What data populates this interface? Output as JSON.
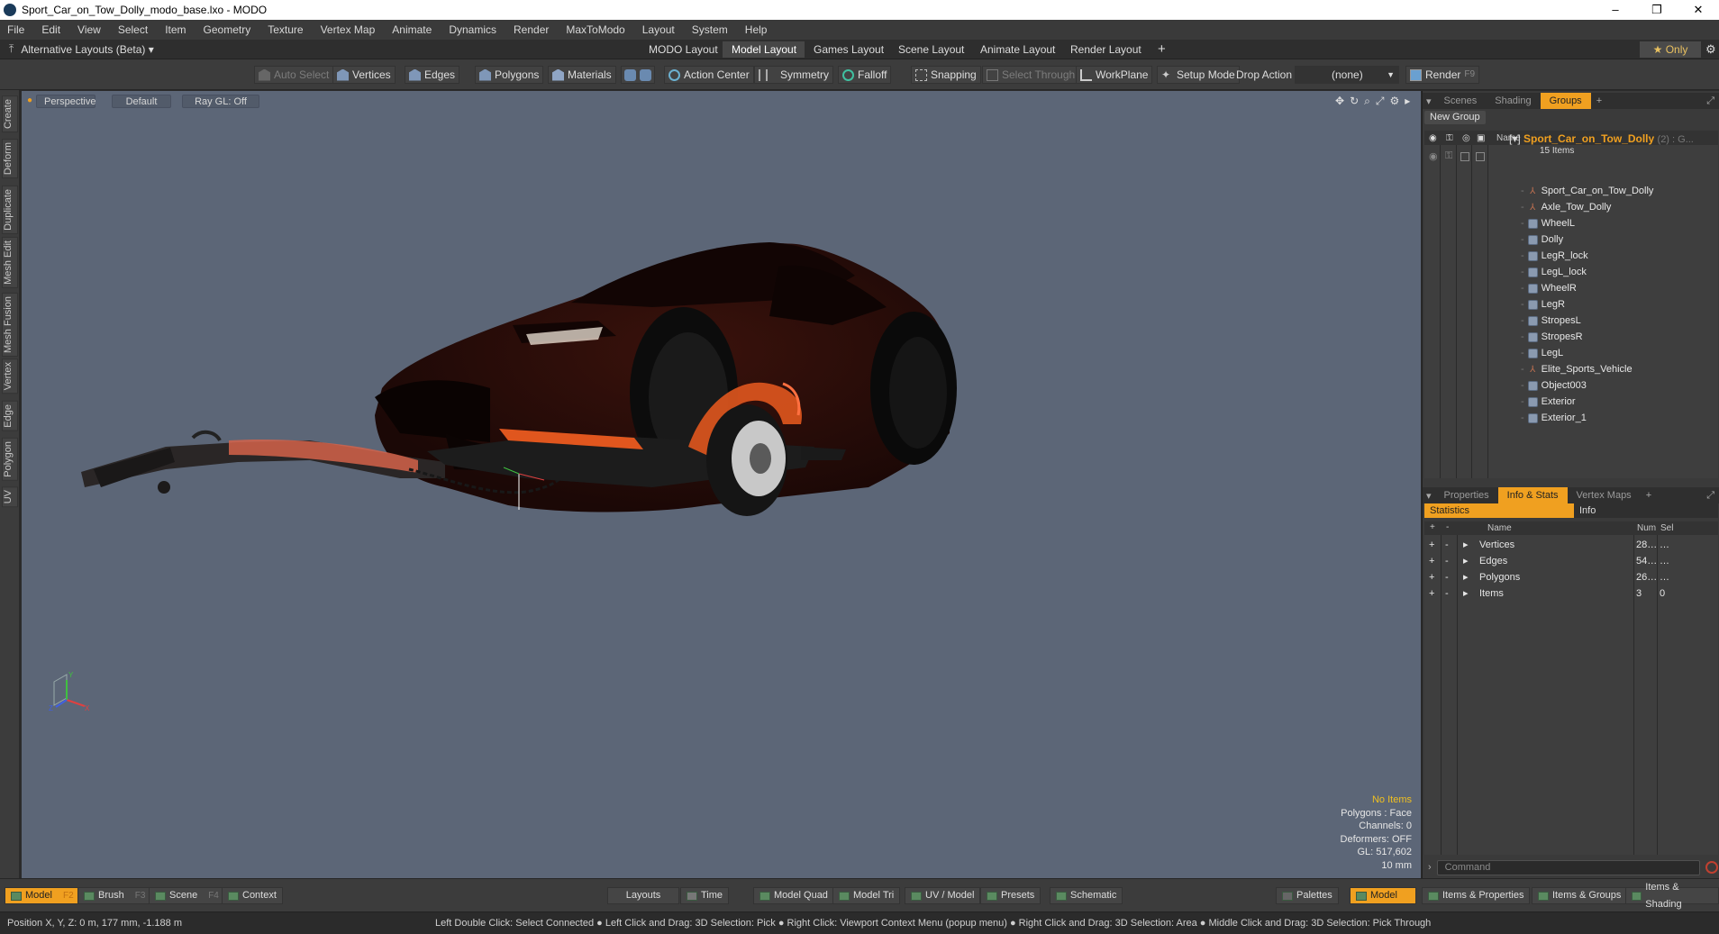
{
  "window": {
    "title": "Sport_Car_on_Tow_Dolly_modo_base.lxo - MODO",
    "minimize": "–",
    "restore": "❐",
    "close": "✕"
  },
  "menu": [
    "File",
    "Edit",
    "View",
    "Select",
    "Item",
    "Geometry",
    "Texture",
    "Vertex Map",
    "Animate",
    "Dynamics",
    "Render",
    "MaxToModo",
    "Layout",
    "System",
    "Help"
  ],
  "layoutbar": {
    "alt_layouts": "Alternative Layouts (Beta) ▾",
    "tabs": [
      "MODO Layout",
      "Model Layout",
      "Games Layout",
      "Scene Layout",
      "Animate Layout",
      "Render Layout"
    ],
    "active_tab": "Model Layout",
    "add": "+",
    "only": "★ Only",
    "settings_icon": "gear-icon"
  },
  "toolbar": {
    "auto_select": "Auto Select",
    "vertices": "Vertices",
    "edges": "Edges",
    "polygons": "Polygons",
    "materials": "Materials",
    "action_center": "Action Center",
    "symmetry": "Symmetry",
    "falloff": "Falloff",
    "snapping": "Snapping",
    "select_through": "Select Through",
    "workplane": "WorkPlane",
    "setup_mode": "Setup Mode",
    "drop_action": "Drop Action",
    "drop_value": "(none)",
    "render": "Render",
    "render_key": "F9"
  },
  "left_tabs": [
    "Create",
    "Deform",
    "Duplicate",
    "Mesh Edit",
    "Mesh Fusion",
    "Vertex",
    "Edge",
    "Polygon",
    "UV"
  ],
  "viewport": {
    "view": "Perspective",
    "shading": "Default",
    "raygl": "Ray GL: Off",
    "stats": {
      "no_items": "No Items",
      "polygons": "Polygons : Face",
      "channels": "Channels: 0",
      "deformers": "Deformers: OFF",
      "gl": "GL: 517,602",
      "scale": "10 mm"
    },
    "axis": {
      "x": "X",
      "y": "Y",
      "z": "Z"
    }
  },
  "groups_panel": {
    "tabs": [
      "Scenes",
      "Shading",
      "Groups"
    ],
    "active_tab": "Groups",
    "new_group": "New Group",
    "col_name": "Name",
    "group_name": "Sport_Car_on_Tow_Dolly",
    "group_suffix": "(2) : G...",
    "group_count": "15 Items",
    "items": [
      {
        "name": "Sport_Car_on_Tow_Dolly",
        "kind": "locator"
      },
      {
        "name": "Axle_Tow_Dolly",
        "kind": "locator"
      },
      {
        "name": "WheelL",
        "kind": "mesh"
      },
      {
        "name": "Dolly",
        "kind": "mesh"
      },
      {
        "name": "LegR_lock",
        "kind": "mesh"
      },
      {
        "name": "LegL_lock",
        "kind": "mesh"
      },
      {
        "name": "WheelR",
        "kind": "mesh"
      },
      {
        "name": "LegR",
        "kind": "mesh"
      },
      {
        "name": "StropesL",
        "kind": "mesh"
      },
      {
        "name": "StropesR",
        "kind": "mesh"
      },
      {
        "name": "LegL",
        "kind": "mesh"
      },
      {
        "name": "Elite_Sports_Vehicle",
        "kind": "locator"
      },
      {
        "name": "Object003",
        "kind": "mesh"
      },
      {
        "name": "Exterior",
        "kind": "mesh"
      },
      {
        "name": "Exterior_1",
        "kind": "mesh"
      }
    ]
  },
  "stats_panel": {
    "tabs": [
      "Properties",
      "Info & Stats",
      "Vertex Maps"
    ],
    "active_tab": "Info & Stats",
    "sub_statistics": "Statistics",
    "sub_info": "Info",
    "col_name": "Name",
    "col_num": "Num",
    "col_sel": "Sel",
    "rows": [
      {
        "name": "Vertices",
        "num": "28…",
        "sel": "…"
      },
      {
        "name": "Edges",
        "num": "54…",
        "sel": "…"
      },
      {
        "name": "Polygons",
        "num": "26…",
        "sel": "…"
      },
      {
        "name": "Items",
        "num": "3",
        "sel": "0"
      }
    ],
    "command_placeholder": "Command"
  },
  "bottombar": {
    "model": "Model",
    "model_key": "F2",
    "brush": "Brush",
    "brush_key": "F3",
    "scene": "Scene",
    "scene_key": "F4",
    "context": "Context",
    "layouts": "Layouts",
    "time": "Time",
    "model_quad": "Model Quad",
    "model_tri": "Model Tri",
    "uv_model": "UV / Model",
    "presets": "Presets",
    "schematic": "Schematic",
    "palettes": "Palettes",
    "model2": "Model",
    "items_properties": "Items & Properties",
    "items_groups": "Items & Groups",
    "items_shading": "Items & Shading"
  },
  "statusbar": {
    "position": "Position X, Y, Z:   0 m, 177 mm, -1.188 m",
    "hints": "Left Double Click: Select Connected ● Left Click and Drag: 3D Selection: Pick ● Right Click: Viewport Context Menu (popup menu) ● Right Click and Drag: 3D Selection: Area ● Middle Click and Drag: 3D Selection: Pick Through"
  },
  "colors": {
    "accent": "#f0a020",
    "viewport_bg": "#5c6677",
    "car_body": "#2a0d08",
    "dolly_orange": "#e0561e"
  }
}
